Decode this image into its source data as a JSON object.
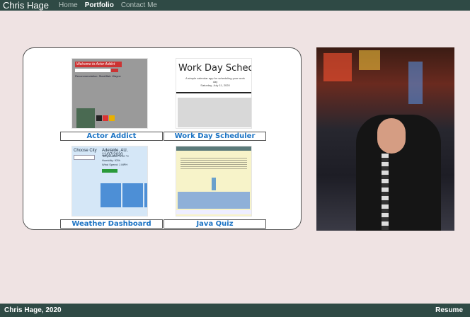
{
  "navbar": {
    "brand": "Chris Hage",
    "links": [
      {
        "label": "Home",
        "active": false
      },
      {
        "label": "Portfolio",
        "active": true
      },
      {
        "label": "Contact Me",
        "active": false
      }
    ]
  },
  "portfolio": {
    "projects": [
      {
        "name": "Actor Addict",
        "thumb": {
          "header": "Welcome to Actor Addict",
          "text": "Recommendation: StarAffair: Wayne"
        }
      },
      {
        "name": "Work Day Scheduler",
        "thumb": {
          "title": "Work Day Scheduler",
          "subtitle": "A simple calendar app for scheduling your work day",
          "date": "Saturday, July 11, 2020"
        }
      },
      {
        "name": "Weather Dashboard",
        "thumb": {
          "search_label": "Choose City",
          "city": "Adelaide, AU, 11/07/2020",
          "temperature": "Temperature: 8.20 °C",
          "humidity": "Humidity: 93%",
          "wind": "Wind Speed: 1 MPH"
        }
      },
      {
        "name": "Java Quiz",
        "thumb": {}
      }
    ]
  },
  "photo": {
    "icon": "profile-photo"
  },
  "footer": {
    "copyright": "Chris Hage, 2020",
    "resume_label": "Resume"
  }
}
